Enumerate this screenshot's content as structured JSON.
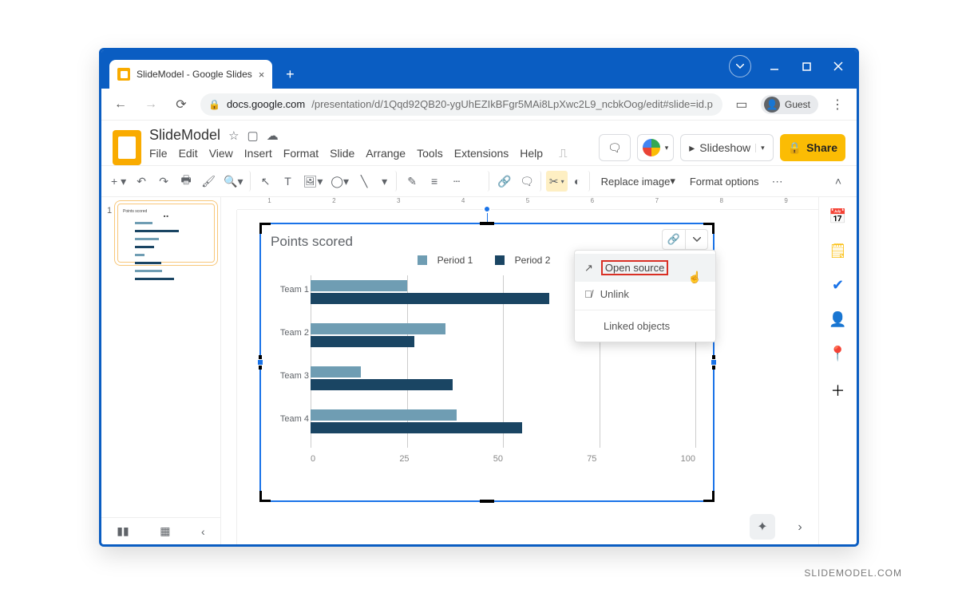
{
  "browser": {
    "tab_title": "SlideModel - Google Slides",
    "url_domain": "docs.google.com",
    "url_path": "/presentation/d/1Qqd92QB20-ygUhEZIkBFgr5MAi8LpXwc2L9_ncbkOog/edit#slide=id.p",
    "guest_label": "Guest"
  },
  "app": {
    "doc_title": "SlideModel",
    "menus": [
      "File",
      "Edit",
      "View",
      "Insert",
      "Format",
      "Slide",
      "Arrange",
      "Tools",
      "Extensions",
      "Help"
    ],
    "slideshow_label": "Slideshow",
    "share_label": "Share",
    "replace_image_label": "Replace image",
    "format_options_label": "Format options"
  },
  "dropdown": {
    "open_source": "Open source",
    "unlink": "Unlink",
    "linked_objects": "Linked objects"
  },
  "chart_data": {
    "type": "bar",
    "orientation": "horizontal",
    "title": "Points scored",
    "categories": [
      "Team 1",
      "Team 2",
      "Team 3",
      "Team 4"
    ],
    "series": [
      {
        "name": "Period 1",
        "color": "#6f9db3",
        "values": [
          25,
          35,
          13,
          38
        ]
      },
      {
        "name": "Period 2",
        "color": "#1a4563",
        "values": [
          62,
          27,
          37,
          55
        ]
      }
    ],
    "xlabel": "",
    "ylabel": "",
    "xlim": [
      0,
      100
    ],
    "xticks": [
      0,
      25,
      50,
      75,
      100
    ]
  },
  "thumbnail": {
    "number": "1"
  },
  "watermark": "SLIDEMODEL.COM"
}
